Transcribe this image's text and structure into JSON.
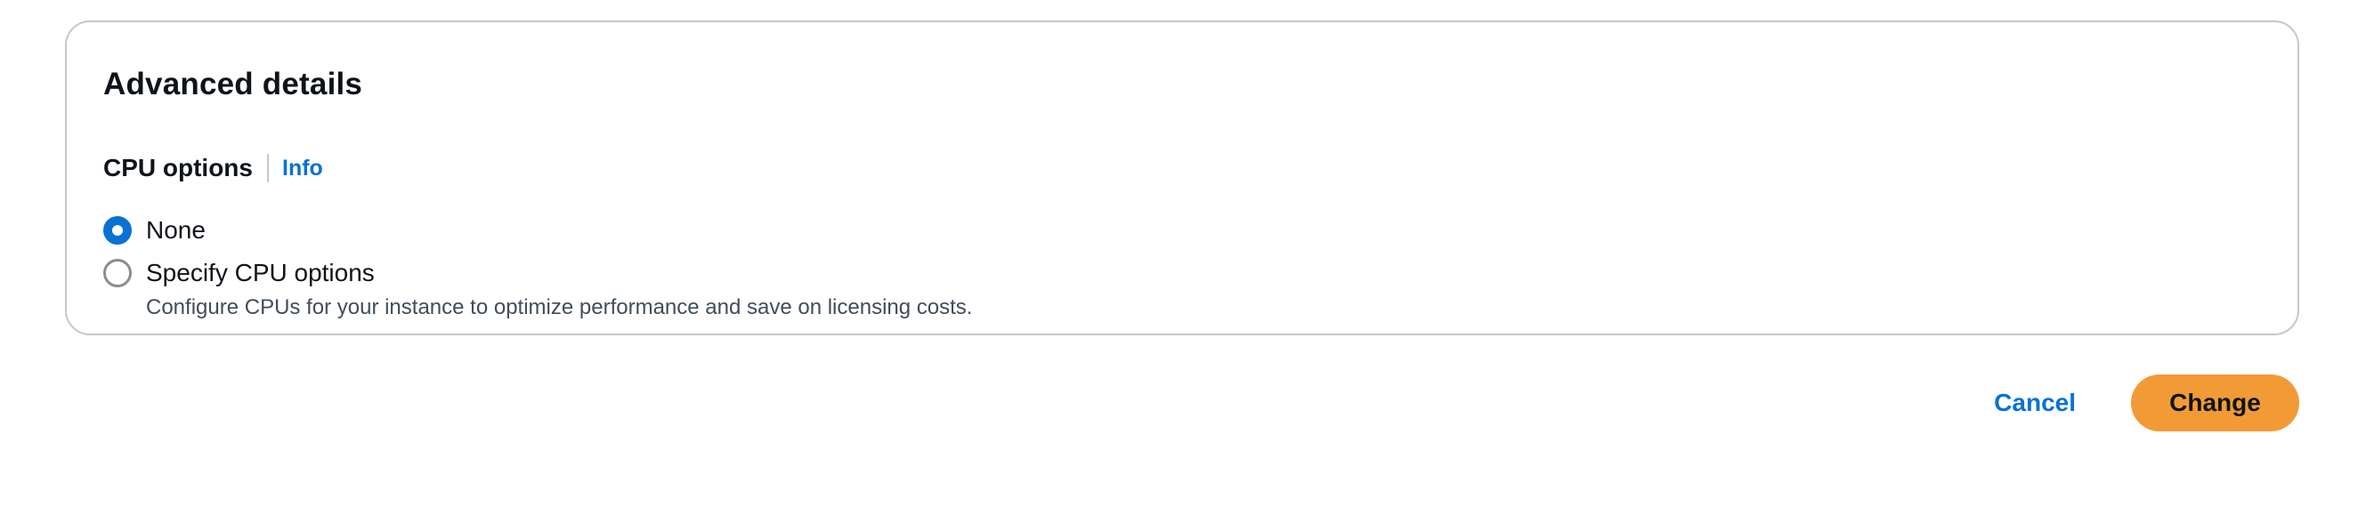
{
  "panel": {
    "title": "Advanced details"
  },
  "cpu_options": {
    "label": "CPU options",
    "info_link": "Info",
    "options": [
      {
        "label": "None",
        "selected": true
      },
      {
        "label": "Specify CPU options",
        "selected": false,
        "description": "Configure CPUs for your instance to optimize performance and save on licensing costs."
      }
    ]
  },
  "actions": {
    "cancel_label": "Cancel",
    "primary_label": "Change"
  },
  "colors": {
    "accent": "#0972d3",
    "primary_button": "#f29b36",
    "border": "#c6c6cd"
  }
}
